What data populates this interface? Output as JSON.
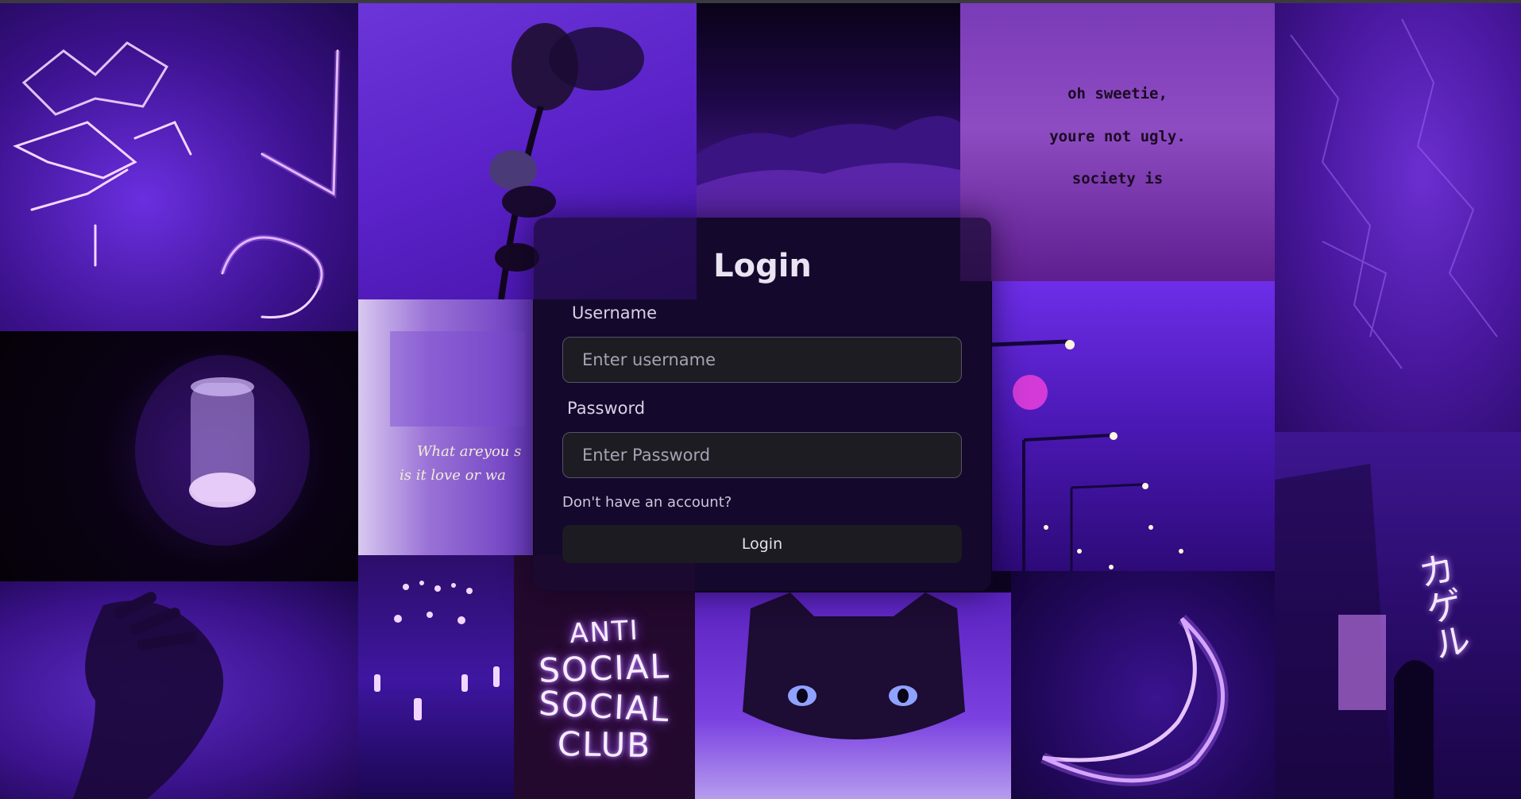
{
  "login": {
    "title": "Login",
    "username_label": "Username",
    "username_placeholder": "Enter username",
    "password_label": "Password",
    "password_placeholder": "Enter Password",
    "signup_link": "Don't have an account?",
    "submit_label": "Login"
  },
  "background": {
    "quote_lines": [
      "oh sweetie,",
      "youre not ugly.",
      "society is"
    ],
    "glitch_lines": [
      "What areyou s",
      "is it love or wa"
    ],
    "club_lines": [
      "ANTI",
      "SOCIAL",
      "SOCIAL",
      "CLUB"
    ],
    "neon_sign": "カゲル"
  },
  "colors": {
    "accent": "#6a2fe0",
    "card_overlay": "#180a30",
    "input_bg": "#1c1c22",
    "button_bg": "#1b1b21"
  }
}
